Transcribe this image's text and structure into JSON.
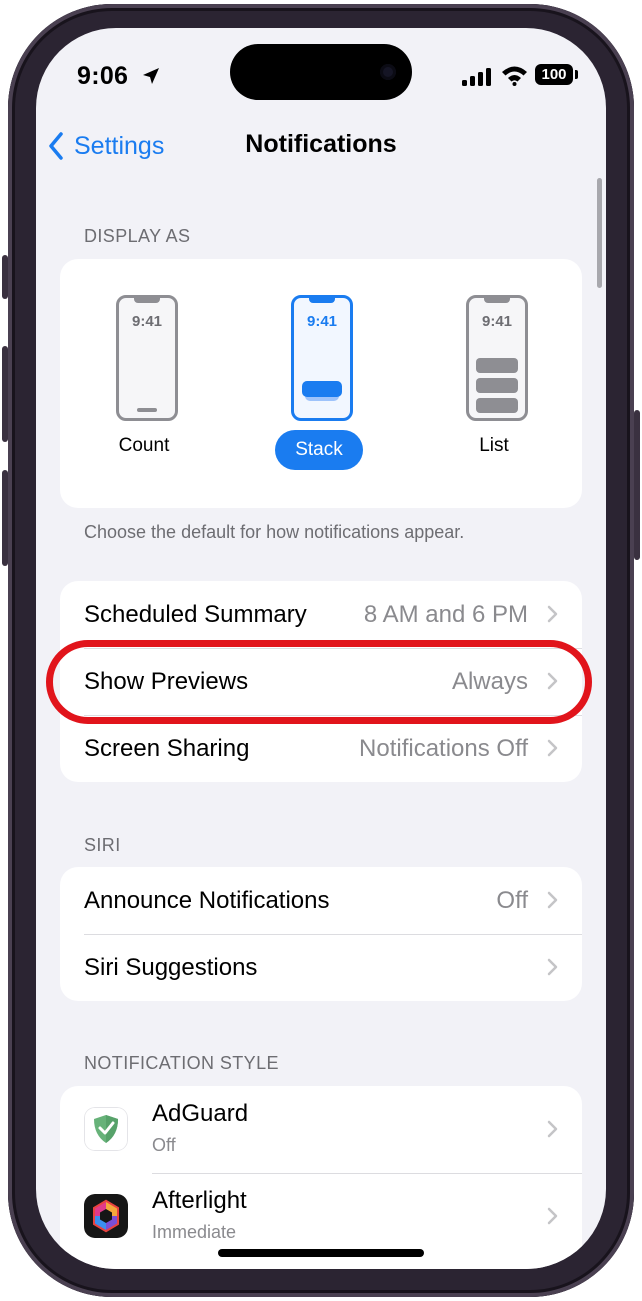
{
  "status_bar": {
    "time": "9:06",
    "battery": "100"
  },
  "nav": {
    "back_label": "Settings",
    "title": "Notifications"
  },
  "display_as": {
    "header": "DISPLAY AS",
    "modes": [
      {
        "label": "Count",
        "clock": "9:41"
      },
      {
        "label": "Stack",
        "clock": "9:41"
      },
      {
        "label": "List",
        "clock": "9:41"
      }
    ],
    "selected": "Stack",
    "footer": "Choose the default for how notifications appear."
  },
  "general_rows": [
    {
      "label": "Scheduled Summary",
      "value": "8 AM and 6 PM"
    },
    {
      "label": "Show Previews",
      "value": "Always"
    },
    {
      "label": "Screen Sharing",
      "value": "Notifications Off"
    }
  ],
  "siri": {
    "header": "SIRI",
    "rows": [
      {
        "label": "Announce Notifications",
        "value": "Off"
      },
      {
        "label": "Siri Suggestions",
        "value": ""
      }
    ]
  },
  "notification_style": {
    "header": "NOTIFICATION STYLE",
    "apps": [
      {
        "name": "AdGuard",
        "status": "Off",
        "icon": "adguard-shield-icon"
      },
      {
        "name": "Afterlight",
        "status": "Immediate",
        "icon": "afterlight-hexagon-icon"
      }
    ]
  },
  "colors": {
    "accent": "#1a7cf0",
    "highlight_ring": "#e1141b",
    "background": "#f2f2f7",
    "secondary_text": "#8a8a8e"
  }
}
